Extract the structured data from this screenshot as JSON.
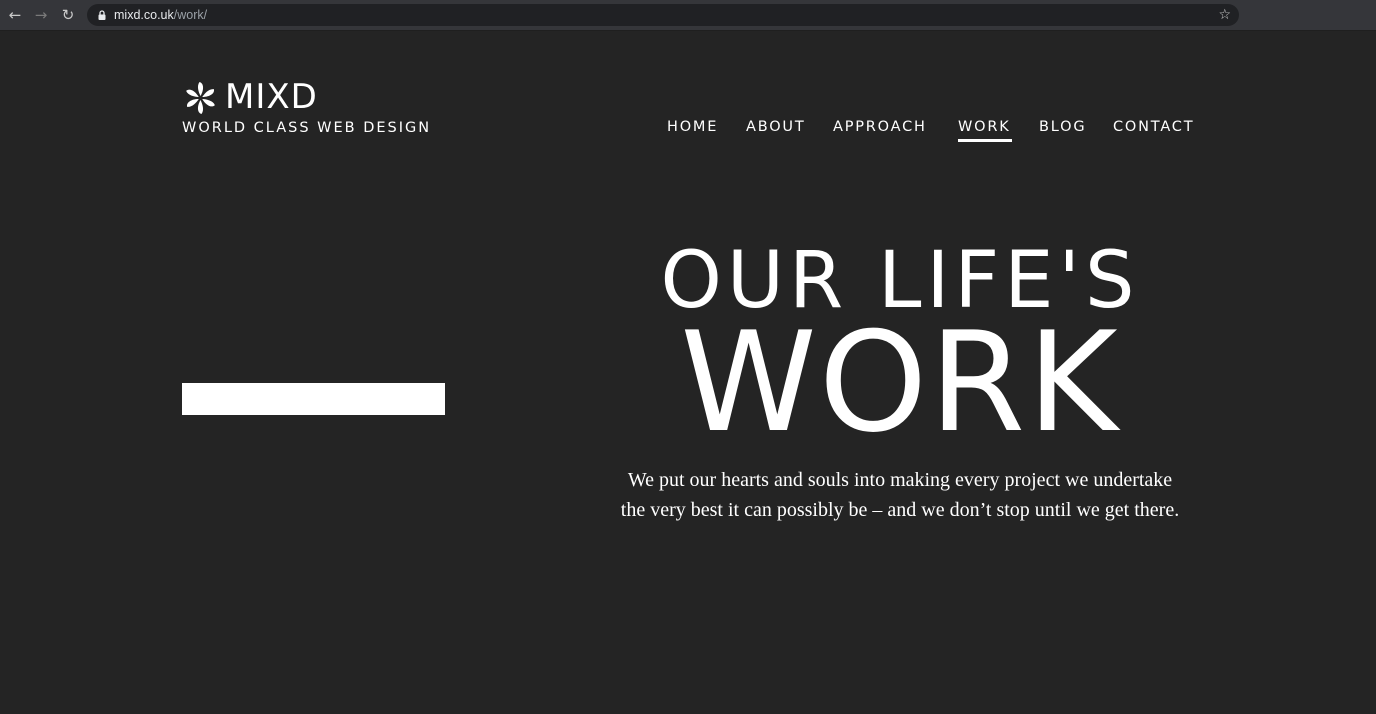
{
  "browser": {
    "url_domain": "mixd.co.uk",
    "url_path": "/work/",
    "back_icon": "arrow-left-icon",
    "forward_icon": "arrow-right-icon",
    "reload_icon": "reload-icon",
    "lock_icon": "lock-icon",
    "bookmark_icon": "star-icon"
  },
  "site": {
    "brand": "MIXD",
    "tagline": "WORLD CLASS WEB DESIGN",
    "logo_icon": "pinwheel-logo-icon"
  },
  "nav": {
    "items": [
      {
        "label": "HOME",
        "active": false
      },
      {
        "label": "ABOUT",
        "active": false
      },
      {
        "label": "APPROACH",
        "active": false
      },
      {
        "label": "WORK",
        "active": true
      },
      {
        "label": "BLOG",
        "active": false
      },
      {
        "label": "CONTACT",
        "active": false
      }
    ]
  },
  "hero": {
    "line1": "OUR LIFE'S",
    "line2": "WORK",
    "description": "We put our hearts and souls into making every project we undertake the very best it can possibly be – and we don’t stop until we get there."
  },
  "colors": {
    "background": "#242424",
    "text": "#ffffff",
    "browser_bar": "#35363a",
    "omnibox": "#202124"
  }
}
